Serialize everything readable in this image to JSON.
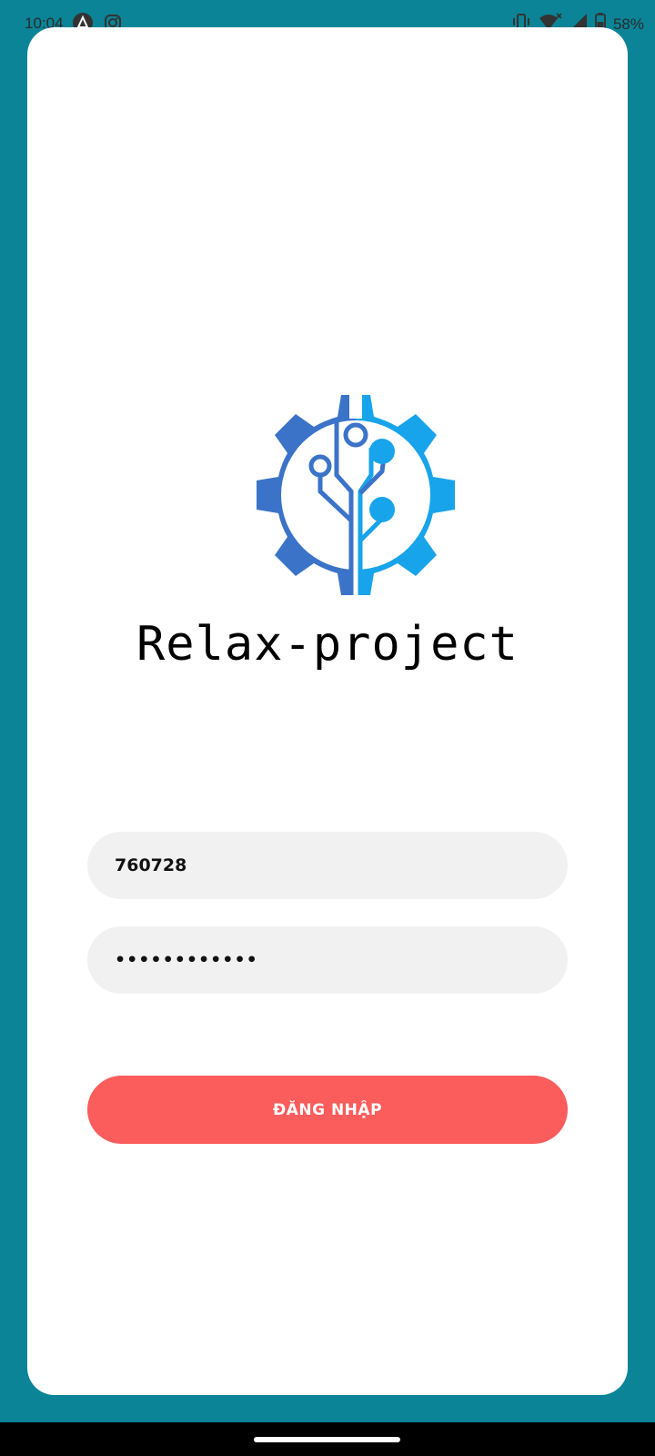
{
  "status_bar": {
    "time": "10:04",
    "battery": "58%",
    "icons": [
      "app-a-icon",
      "instagram-icon",
      "vibrate-icon",
      "wifi-icon",
      "signal-icon",
      "battery-icon"
    ]
  },
  "app": {
    "name": "Relax-project",
    "logo_icon": "gear-circuit-logo-icon"
  },
  "login_form": {
    "username_value": "760728",
    "password_value": "••••••••••••",
    "submit_label": "ĐĂNG NHẬP"
  },
  "colors": {
    "background": "#0a8496",
    "card": "#ffffff",
    "input_background": "#f1f1f1",
    "button": "#fb5c5c",
    "logo_dark_blue": "#3b73c8",
    "logo_light_blue": "#18a4ea"
  }
}
